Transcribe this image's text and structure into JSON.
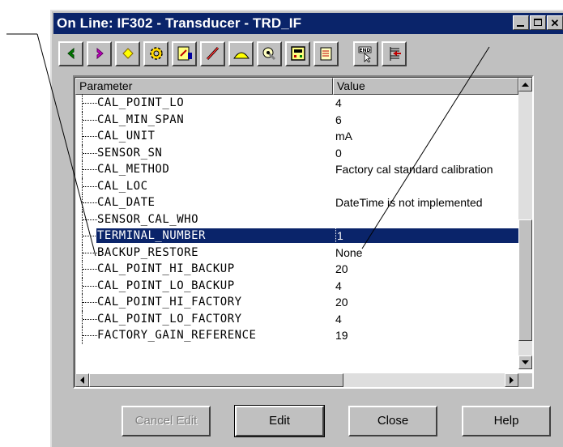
{
  "window": {
    "title": "On Line: IF302 - Transducer - TRD_IF"
  },
  "titlebar_buttons": {
    "minimize": "_",
    "maximize": "□",
    "close": "✕"
  },
  "toolbar": {
    "tools": [
      {
        "icon": "back-arrow-icon"
      },
      {
        "icon": "forward-arrow-icon"
      },
      {
        "icon": "diamond-icon"
      },
      {
        "icon": "gear-icon"
      },
      {
        "icon": "meter-icon"
      },
      {
        "icon": "pen-icon"
      },
      {
        "icon": "chart-icon"
      },
      {
        "icon": "wrench-globe-icon"
      },
      {
        "icon": "display-device-icon"
      },
      {
        "icon": "scroll-icon"
      },
      {
        "icon": "end-cursor-icon",
        "label": "END"
      },
      {
        "icon": "list-arrow-icon"
      }
    ]
  },
  "grid": {
    "headers": {
      "parameter": "Parameter",
      "value": "Value"
    },
    "rows": [
      {
        "name": "CAL_POINT_LO",
        "value": "4"
      },
      {
        "name": "CAL_MIN_SPAN",
        "value": "6"
      },
      {
        "name": "CAL_UNIT",
        "value": "mA"
      },
      {
        "name": "SENSOR_SN",
        "value": "0"
      },
      {
        "name": "CAL_METHOD",
        "value": "Factory cal standard calibration"
      },
      {
        "name": "CAL_LOC",
        "value": ""
      },
      {
        "name": "CAL_DATE",
        "value": "DateTime is not implemented"
      },
      {
        "name": "SENSOR_CAL_WHO",
        "value": ""
      },
      {
        "name": "TERMINAL_NUMBER",
        "value": "1",
        "selected": true
      },
      {
        "name": "BACKUP_RESTORE",
        "value": "None"
      },
      {
        "name": "CAL_POINT_HI_BACKUP",
        "value": "20"
      },
      {
        "name": "CAL_POINT_LO_BACKUP",
        "value": "4"
      },
      {
        "name": "CAL_POINT_HI_FACTORY",
        "value": "20"
      },
      {
        "name": "CAL_POINT_LO_FACTORY",
        "value": "4"
      },
      {
        "name": "FACTORY_GAIN_REFERENCE",
        "value": "19"
      }
    ]
  },
  "buttons": {
    "cancel_edit": "Cancel Edit",
    "edit": "Edit",
    "close": "Close",
    "help": "Help"
  },
  "colors": {
    "title_bar": "#0a246a",
    "selection": "#0a246a",
    "face": "#c0c0c0"
  }
}
